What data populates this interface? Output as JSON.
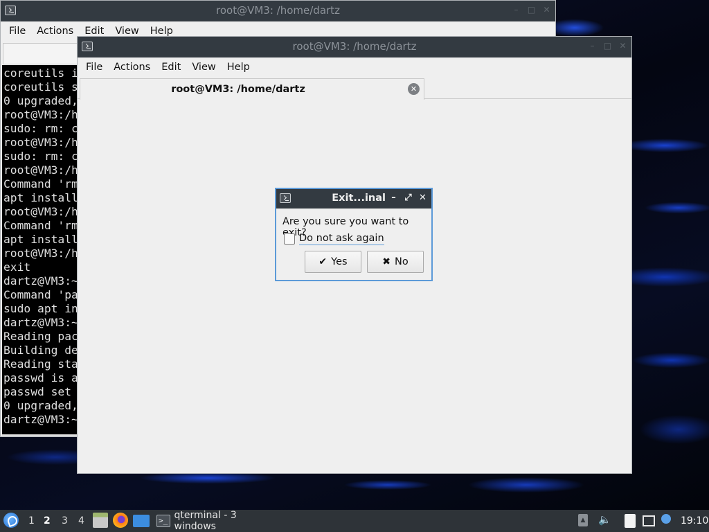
{
  "back_window": {
    "title": "root@VM3: /home/dartz",
    "menu": [
      "File",
      "Actions",
      "Edit",
      "View",
      "Help"
    ],
    "terminal_lines": [
      "coreutils i",
      "coreutils s",
      "0 upgraded,",
      "root@VM3:/h",
      "sudo: rm: c",
      "root@VM3:/h",
      "sudo: rm: c",
      "root@VM3:/h",
      "Command 'rm",
      "apt install",
      "root@VM3:/h",
      "Command 'rm",
      "apt install",
      "root@VM3:/h",
      "exit",
      "dartz@VM3:~",
      "Command 'pa",
      "sudo apt in",
      "dartz@VM3:~",
      "Reading pac",
      "Building de",
      "Reading sta",
      "passwd is a",
      "passwd set",
      "0 upgraded,",
      "dartz@VM3:~"
    ]
  },
  "front_window": {
    "title": "root@VM3: /home/dartz",
    "menu": [
      "File",
      "Actions",
      "Edit",
      "View",
      "Help"
    ],
    "tab_label": "root@VM3: /home/dartz",
    "tab_close_glyph": "✕"
  },
  "dialog": {
    "title": "Exit...inal",
    "question": "Are you sure you want to exit?",
    "checkbox_label": "Do not ask again",
    "checkbox_checked": false,
    "yes_glyph": "✔",
    "yes_label": "Yes",
    "no_glyph": "✖",
    "no_label": "No",
    "ctrl_minimize": "–",
    "ctrl_maximize": "⤢",
    "ctrl_close": "✕"
  },
  "taskbar": {
    "workspaces": [
      "1",
      "2",
      "3",
      "4"
    ],
    "active_workspace": "2",
    "task_label": "qterminal - 3 windows",
    "clock": "19:10"
  },
  "colors": {
    "titlebar": "#333a41",
    "dialog_border": "#5c9ad8",
    "terminal_bg": "#000000",
    "taskbar": "#2e3338"
  }
}
